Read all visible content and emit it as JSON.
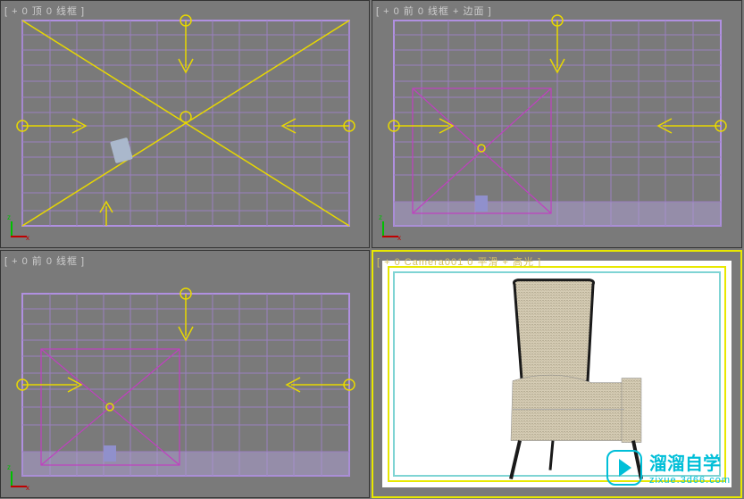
{
  "viewports": {
    "top_left": {
      "label": "[ + 0 顶 0 线框 ]"
    },
    "top_right": {
      "label": "[ + 0 前 0 线框 + 边面 ]"
    },
    "bottom_left": {
      "label": "[ + 0 前 0 线框 ]"
    },
    "bottom_right": {
      "label": "[ + 0 Camera001 0 平滑 + 高光 ]"
    }
  },
  "watermark": {
    "title": "溜溜自学",
    "url": "zixue.3d66.com"
  }
}
